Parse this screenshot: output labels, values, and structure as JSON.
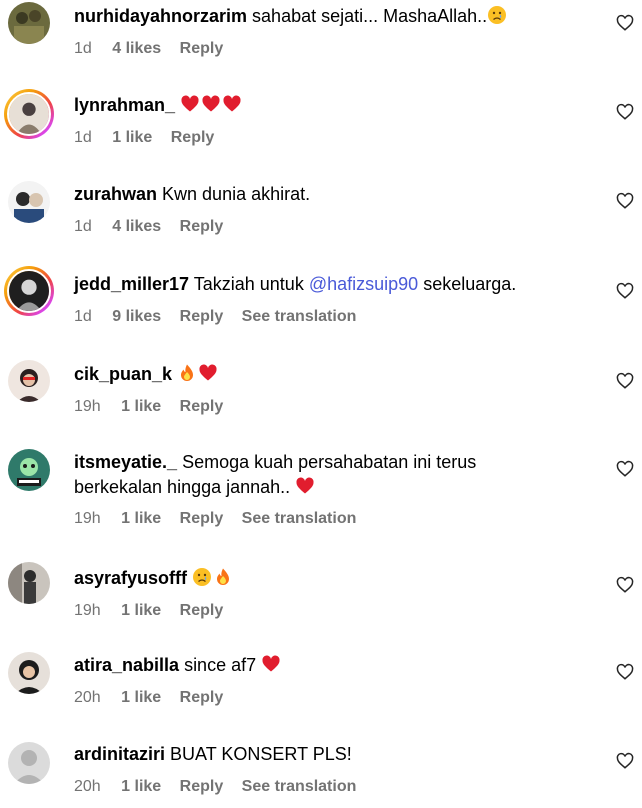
{
  "comments": [
    {
      "user": "nurhidayahnorzarim",
      "text": "sahabat sejati... MashaAllah..",
      "emoji_after": [
        "crying-face"
      ],
      "time": "1d",
      "likes": "4 likes",
      "reply": "Reply"
    },
    {
      "user": "lynrahman_",
      "text": "",
      "emoji_after": [
        "red-heart",
        "red-heart",
        "red-heart"
      ],
      "time": "1d",
      "likes": "1 like",
      "reply": "Reply"
    },
    {
      "user": "zurahwan",
      "text": "Kwn dunia akhirat.",
      "emoji_after": [],
      "time": "1d",
      "likes": "4 likes",
      "reply": "Reply"
    },
    {
      "user": "jedd_miller17",
      "text_before": "Takziah untuk",
      "mention": "@hafizsuip90",
      "text_after": "sekeluarga.",
      "time": "1d",
      "likes": "9 likes",
      "reply": "Reply",
      "translate": "See translation"
    },
    {
      "user": "cik_puan_k",
      "text": "",
      "emoji_after": [
        "fire",
        "red-heart"
      ],
      "time": "19h",
      "likes": "1 like",
      "reply": "Reply"
    },
    {
      "user": "itsmeyatie._",
      "text": "Semoga kuah persahabatan ini terus",
      "text_line2": "berkekalan hingga jannah..",
      "emoji_after": [
        "red-heart"
      ],
      "time": "19h",
      "likes": "1 like",
      "reply": "Reply",
      "translate": "See translation"
    },
    {
      "user": "asyrafyusofff",
      "text": "",
      "emoji_after": [
        "crying-face",
        "fire"
      ],
      "time": "19h",
      "likes": "1 like",
      "reply": "Reply"
    },
    {
      "user": "atira_nabilla",
      "text": "since af7",
      "emoji_after": [
        "red-heart"
      ],
      "time": "20h",
      "likes": "1 like",
      "reply": "Reply"
    },
    {
      "user": "ardinitaziri",
      "text": "BUAT KONSERT PLS!",
      "emoji_after": [],
      "time": "20h",
      "likes": "1 like",
      "reply": "Reply",
      "translate": "See translation"
    }
  ],
  "icons": {
    "like": "heart-outline-icon"
  }
}
